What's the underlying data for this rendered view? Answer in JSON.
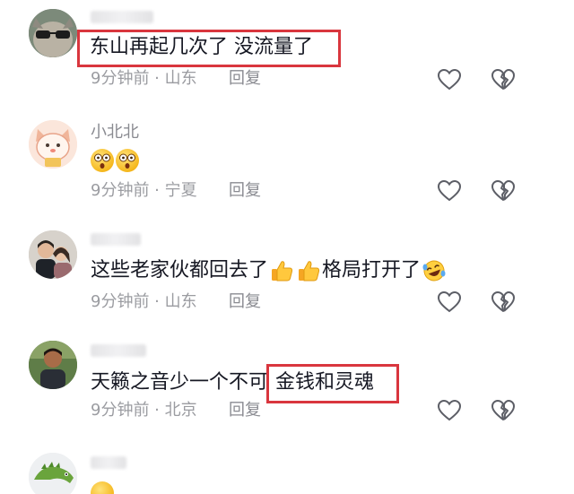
{
  "comments": [
    {
      "username": "",
      "text": "东山再起几次了 没流量了",
      "time": "9分钟前",
      "location": "山东",
      "reply_label": "回复",
      "avatar_icon": "sunglasses-cat-avatar"
    },
    {
      "username": "小北北",
      "emoji_count": 2,
      "time": "9分钟前",
      "location": "宁夏",
      "reply_label": "回复",
      "avatar_icon": "cartoon-cat-avatar"
    },
    {
      "username": "",
      "text_a": "这些老家伙都回去了",
      "text_b": "格局打开了",
      "time": "9分钟前",
      "location": "山东",
      "reply_label": "回复",
      "avatar_icon": "couple-photo-avatar"
    },
    {
      "username": "",
      "text_a": "天籁之音少一个不可",
      "text_b": "金钱和灵魂",
      "time": "9分钟前",
      "location": "北京",
      "reply_label": "回复",
      "avatar_icon": "child-photo-avatar"
    },
    {
      "username": "",
      "avatar_icon": "dinosaur-toy-avatar"
    }
  ],
  "separator": " · ",
  "colors": {
    "highlight_box": "#d9363e",
    "meta_text": "#9b9ca1",
    "body_text": "#161823"
  }
}
